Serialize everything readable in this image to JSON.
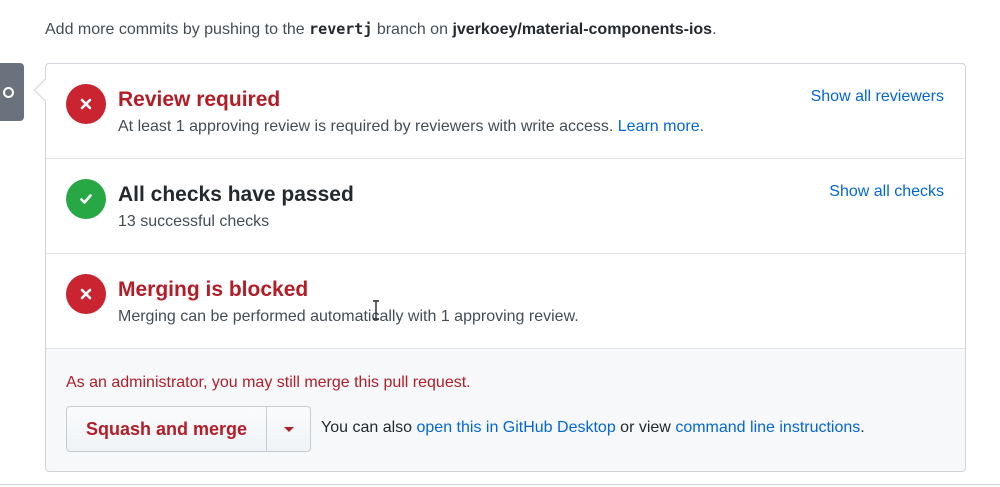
{
  "hint": {
    "prefix": "Add more commits by pushing to the",
    "branch": "revertj",
    "middle": "branch on",
    "repo": "jverkoey/material-components-ios",
    "suffix": "."
  },
  "reviews": {
    "title": "Review required",
    "description": "At least 1 approving review is required by reviewers with write access.",
    "learn_more": "Learn more.",
    "action": "Show all reviewers",
    "status_icon": "x-icon"
  },
  "checks": {
    "title": "All checks have passed",
    "description": "13 successful checks",
    "action": "Show all checks",
    "status_icon": "check-icon"
  },
  "merge_status": {
    "title": "Merging is blocked",
    "description": "Merging can be performed automatically with 1 approving review.",
    "status_icon": "x-icon"
  },
  "merge": {
    "admin_note": "As an administrator, you may still merge this pull request.",
    "button_label": "Squash and merge",
    "alt_prefix": "You can also",
    "desktop_link": "open this in GitHub Desktop",
    "alt_middle": "or view",
    "cli_link": "command line instructions",
    "alt_suffix": "."
  },
  "colors": {
    "fail": "#cb2431",
    "success": "#28a745",
    "link": "#0366d6",
    "danger_text": "#b31d28"
  }
}
